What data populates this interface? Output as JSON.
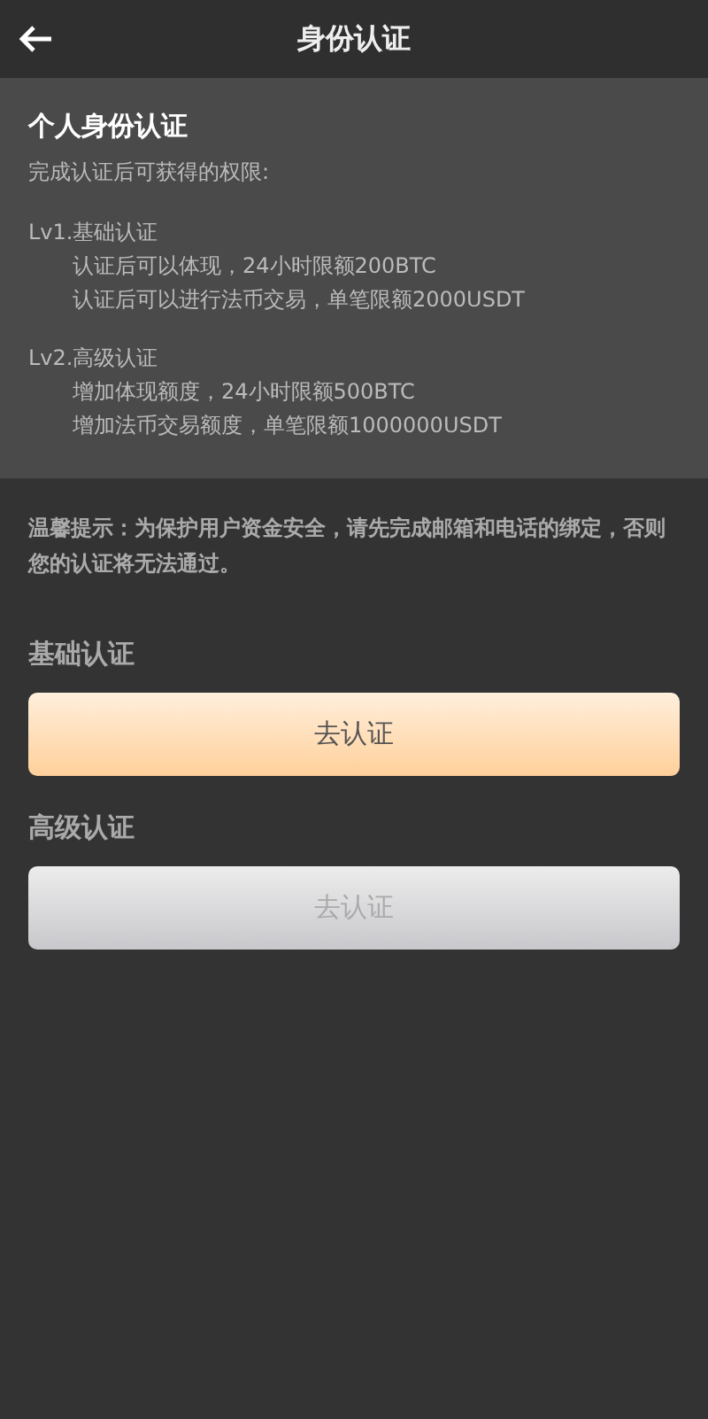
{
  "header": {
    "title": "身份认证"
  },
  "info": {
    "title": "个人身份认证",
    "subtitle": "完成认证后可获得的权限:",
    "levels": [
      {
        "name": "Lv1.基础认证",
        "benefits": [
          "认证后可以体现，24小时限额200BTC",
          "认证后可以进行法币交易，单笔限额2000USDT"
        ]
      },
      {
        "name": "Lv2.高级认证",
        "benefits": [
          "增加体现额度，24小时限额500BTC",
          "增加法币交易额度，单笔限额1000000USDT"
        ]
      }
    ]
  },
  "notice": "温馨提示：为保护用户资金安全，请先完成邮箱和电话的绑定，否则您的认证将无法通过。",
  "sections": [
    {
      "label": "基础认证",
      "button": "去认证",
      "disabled": false
    },
    {
      "label": "高级认证",
      "button": "去认证",
      "disabled": true
    }
  ]
}
